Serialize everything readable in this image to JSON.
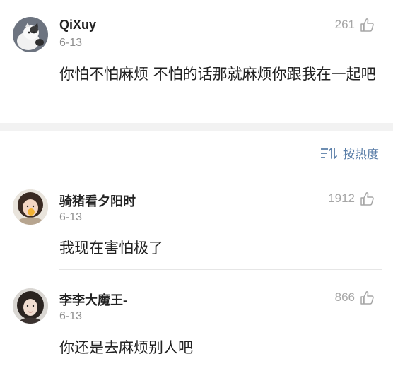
{
  "top_comment": {
    "username": "QiXuy",
    "date": "6-13",
    "likes": "261",
    "text": "你怕不怕麻烦 不怕的话那就麻烦你跟我在一起吧"
  },
  "sort": {
    "label": "按热度",
    "icon": "sort-icon"
  },
  "comments": [
    {
      "username": "骑猪看夕阳时",
      "date": "6-13",
      "likes": "1912",
      "text": "我现在害怕极了"
    },
    {
      "username": "李李大魔王-",
      "date": "6-13",
      "likes": "866",
      "text": "你还是去麻烦别人吧"
    }
  ],
  "colors": {
    "sort_accent": "#5a7ea8",
    "muted": "#a6a6a6",
    "separator": "#f2f2f2"
  }
}
